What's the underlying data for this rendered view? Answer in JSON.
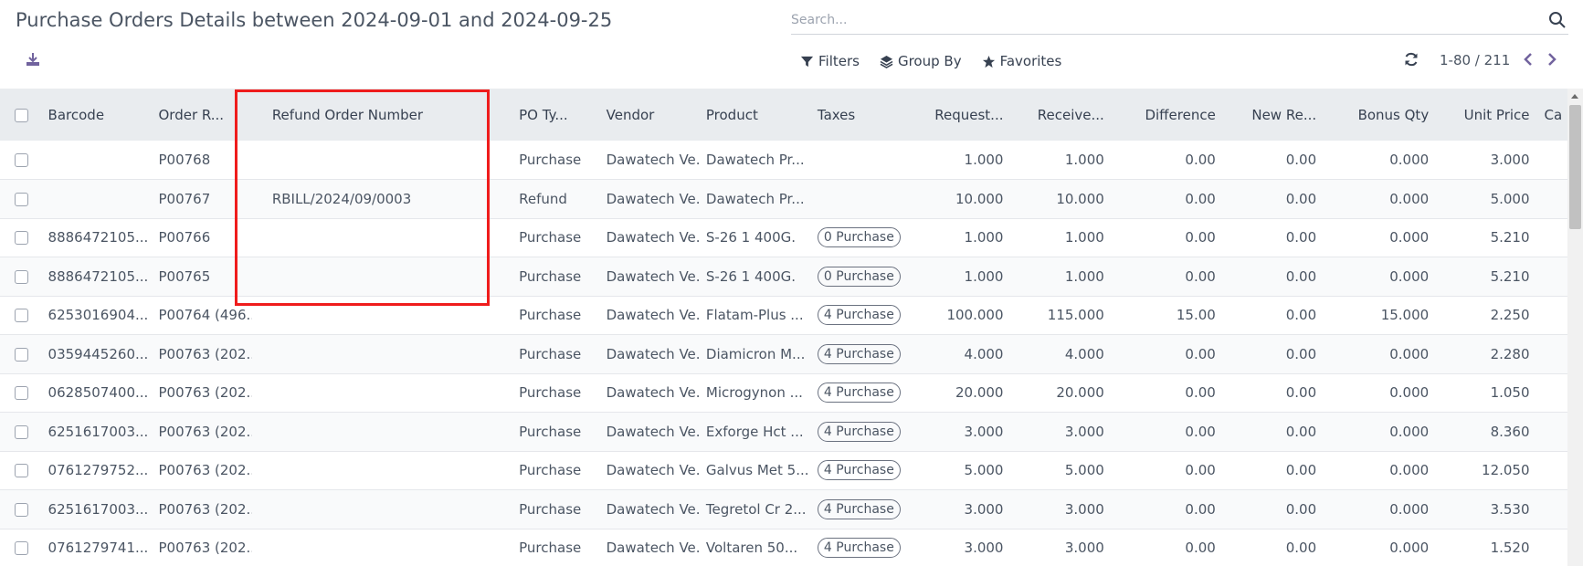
{
  "page": {
    "title": "Purchase Orders Details between 2024-09-01 and 2024-09-25"
  },
  "icons": {
    "download": "download-icon",
    "search": "search-icon",
    "filter": "filter-icon",
    "group": "layers-icon",
    "favorites": "star-icon",
    "refresh": "refresh-icon",
    "prev": "chevron-left-icon",
    "next": "chevron-right-icon"
  },
  "search": {
    "placeholder": "Search...",
    "value": ""
  },
  "toolbar": {
    "filters_label": "Filters",
    "group_by_label": "Group By",
    "favorites_label": "Favorites"
  },
  "pager": {
    "range": "1-80 / 211"
  },
  "table": {
    "headers": [
      "Barcode",
      "Order R...",
      "Refund Order Number",
      "PO Ty...",
      "Vendor",
      "Product",
      "Taxes",
      "Request...",
      "Receive...",
      "Difference",
      "New Re...",
      "Bonus Qty",
      "Unit Price",
      "Ca"
    ],
    "rows": [
      {
        "barcode": "",
        "order": "P00768",
        "refund": "",
        "po_type": "Purchase",
        "vendor": "Dawatech Ve...",
        "product": "Dawatech Pr...",
        "taxes": "",
        "requested": "1.000",
        "received": "1.000",
        "difference": "0.00",
        "new_re": "0.00",
        "bonus": "0.000",
        "unit_price": "3.000"
      },
      {
        "barcode": "",
        "order": "P00767",
        "refund": "RBILL/2024/09/0003",
        "po_type": "Refund",
        "vendor": "Dawatech Ve...",
        "product": "Dawatech Pr...",
        "taxes": "",
        "requested": "10.000",
        "received": "10.000",
        "difference": "0.00",
        "new_re": "0.00",
        "bonus": "0.000",
        "unit_price": "5.000"
      },
      {
        "barcode": "8886472105...",
        "order": "P00766",
        "refund": "",
        "po_type": "Purchase",
        "vendor": "Dawatech Ve...",
        "product": "S-26 1 400G.",
        "taxes": "0 Purchase",
        "requested": "1.000",
        "received": "1.000",
        "difference": "0.00",
        "new_re": "0.00",
        "bonus": "0.000",
        "unit_price": "5.210"
      },
      {
        "barcode": "8886472105...",
        "order": "P00765",
        "refund": "",
        "po_type": "Purchase",
        "vendor": "Dawatech Ve...",
        "product": "S-26 1 400G.",
        "taxes": "0 Purchase",
        "requested": "1.000",
        "received": "1.000",
        "difference": "0.00",
        "new_re": "0.00",
        "bonus": "0.000",
        "unit_price": "5.210"
      },
      {
        "barcode": "6253016904...",
        "order": "P00764 (496...",
        "refund": "",
        "po_type": "Purchase",
        "vendor": "Dawatech Ve...",
        "product": "Flatam-Plus ...",
        "taxes": "4 Purchase",
        "requested": "100.000",
        "received": "115.000",
        "difference": "15.00",
        "new_re": "0.00",
        "bonus": "15.000",
        "unit_price": "2.250"
      },
      {
        "barcode": "0359445260...",
        "order": "P00763 (202...",
        "refund": "",
        "po_type": "Purchase",
        "vendor": "Dawatech Ve...",
        "product": "Diamicron M...",
        "taxes": "4 Purchase",
        "requested": "4.000",
        "received": "4.000",
        "difference": "0.00",
        "new_re": "0.00",
        "bonus": "0.000",
        "unit_price": "2.280"
      },
      {
        "barcode": "0628507400...",
        "order": "P00763 (202...",
        "refund": "",
        "po_type": "Purchase",
        "vendor": "Dawatech Ve...",
        "product": "Microgynon ...",
        "taxes": "4 Purchase",
        "requested": "20.000",
        "received": "20.000",
        "difference": "0.00",
        "new_re": "0.00",
        "bonus": "0.000",
        "unit_price": "1.050"
      },
      {
        "barcode": "6251617003...",
        "order": "P00763 (202...",
        "refund": "",
        "po_type": "Purchase",
        "vendor": "Dawatech Ve...",
        "product": "Exforge Hct ...",
        "taxes": "4 Purchase",
        "requested": "3.000",
        "received": "3.000",
        "difference": "0.00",
        "new_re": "0.00",
        "bonus": "0.000",
        "unit_price": "8.360"
      },
      {
        "barcode": "0761279752...",
        "order": "P00763 (202...",
        "refund": "",
        "po_type": "Purchase",
        "vendor": "Dawatech Ve...",
        "product": "Galvus Met 5...",
        "taxes": "4 Purchase",
        "requested": "5.000",
        "received": "5.000",
        "difference": "0.00",
        "new_re": "0.00",
        "bonus": "0.000",
        "unit_price": "12.050"
      },
      {
        "barcode": "6251617003...",
        "order": "P00763 (202...",
        "refund": "",
        "po_type": "Purchase",
        "vendor": "Dawatech Ve...",
        "product": "Tegretol Cr 2...",
        "taxes": "4 Purchase",
        "requested": "3.000",
        "received": "3.000",
        "difference": "0.00",
        "new_re": "0.00",
        "bonus": "0.000",
        "unit_price": "3.530"
      },
      {
        "barcode": "0761279741...",
        "order": "P00763 (202...",
        "refund": "",
        "po_type": "Purchase",
        "vendor": "Dawatech Ve...",
        "product": "Voltaren 50...",
        "taxes": "4 Purchase",
        "requested": "3.000",
        "received": "3.000",
        "difference": "0.00",
        "new_re": "0.00",
        "bonus": "0.000",
        "unit_price": "1.520"
      }
    ]
  },
  "colors": {
    "highlight": "#ef1c1c",
    "header_bg": "#e9ecef",
    "accent": "#71639e"
  }
}
